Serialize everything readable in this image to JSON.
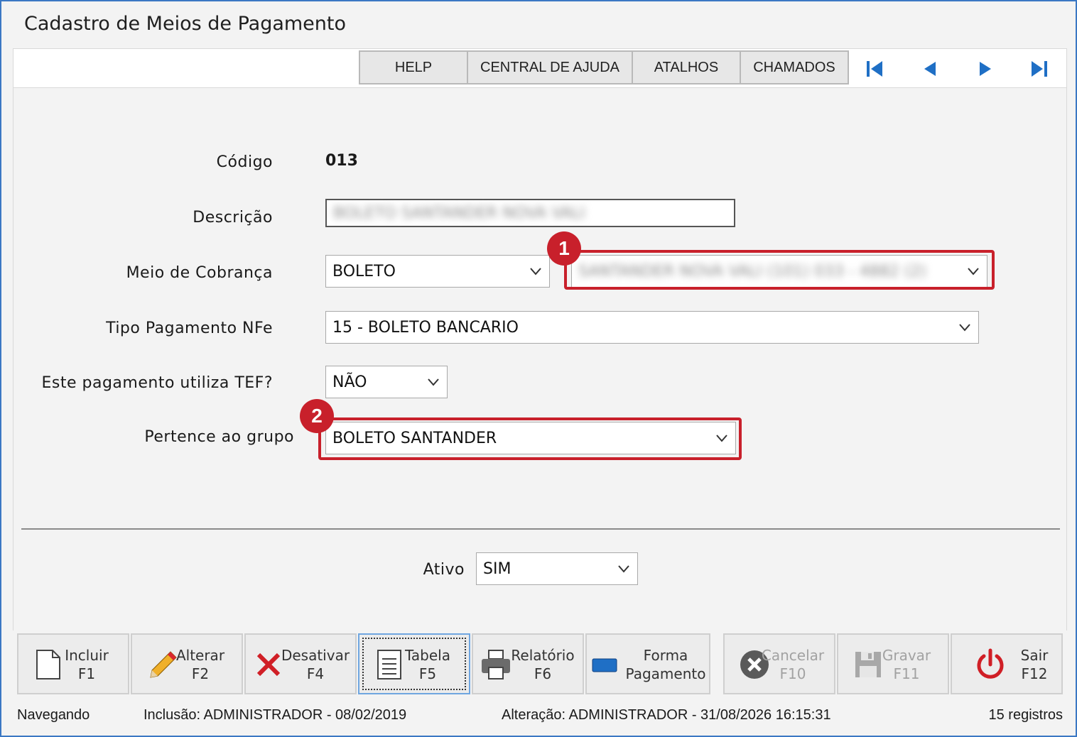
{
  "window": {
    "title": "Cadastro de Meios de Pagamento"
  },
  "toolbar": {
    "help": "HELP",
    "central": "CENTRAL DE AJUDA",
    "atalhos": "ATALHOS",
    "chamados": "CHAMADOS",
    "nav_icons": [
      "first-record-icon",
      "previous-record-icon",
      "next-record-icon",
      "last-record-icon"
    ]
  },
  "form": {
    "codigo_label": "Código",
    "codigo_value": "013",
    "descricao_label": "Descrição",
    "descricao_value": "BOLETO SANTANDER NOVA VALI",
    "meio_label": "Meio de Cobrança",
    "meio_value": "BOLETO",
    "conta_value": "SANTANDER NOVA VALI (101) 033 - 4882 (2)",
    "tipo_label": "Tipo Pagamento NFe",
    "tipo_value": "15 - BOLETO BANCARIO",
    "tef_label": "Este pagamento utiliza TEF?",
    "tef_value": "NÃO",
    "grupo_label": "Pertence ao grupo",
    "grupo_value": "BOLETO SANTANDER",
    "ativo_label": "Ativo",
    "ativo_value": "SIM"
  },
  "annotations": {
    "badge1": "1",
    "badge2": "2",
    "highlight_color": "#c8202b"
  },
  "buttons": [
    {
      "line1": "Incluir",
      "line2": "F1",
      "icon": "new-document-icon"
    },
    {
      "line1": "Alterar",
      "line2": "F2",
      "icon": "pencil-icon"
    },
    {
      "line1": "Desativar",
      "line2": "F4",
      "icon": "x-icon"
    },
    {
      "line1": "Tabela",
      "line2": "F5",
      "icon": "table-document-icon"
    },
    {
      "line1": "Relatório",
      "line2": "F6",
      "icon": "printer-icon"
    },
    {
      "line1": "Forma",
      "line2": "Pagamento",
      "icon": "blue-card-icon"
    },
    {
      "line1": "Cancelar",
      "line2": "F10",
      "icon": "cancel-circle-icon"
    },
    {
      "line1": "Gravar",
      "line2": "F11",
      "icon": "floppy-disk-icon"
    },
    {
      "line1": "Sair",
      "line2": "F12",
      "icon": "power-icon"
    }
  ],
  "status": {
    "mode": "Navegando",
    "inclusao": "Inclusão: ADMINISTRADOR - 08/02/2019",
    "alteracao": "Alteração: ADMINISTRADOR - 31/08/2026 16:15:31",
    "registros": "15 registros"
  }
}
